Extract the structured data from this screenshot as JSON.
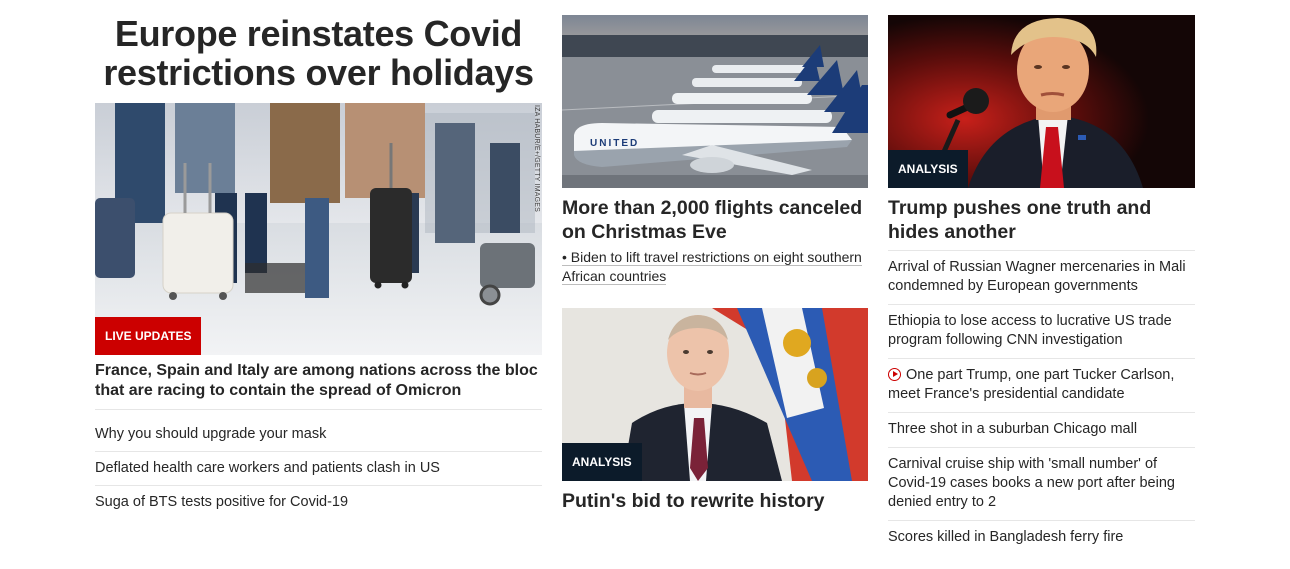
{
  "lead": {
    "title": "Europe reinstates Covid restrictions over holidays",
    "image_alt": "Travelers with rolling suitcases in an airport terminal",
    "photo_credit": "IZA HABUR/E+/GETTY IMAGES",
    "badge": "LIVE UPDATES",
    "subheadline": "France, Spain and Italy are among nations across the bloc that are racing to contain the spread of Omicron",
    "links": [
      "Why you should upgrade your mask",
      "Deflated health care workers and patients clash in US",
      "Suga of BTS tests positive for Covid-19"
    ]
  },
  "flights": {
    "image_alt": "United Airlines planes parked at an airport",
    "headline": "More than 2,000 flights canceled on Christmas Eve",
    "related": "Biden to lift travel restrictions on eight southern African countries",
    "plane_livery": "UNITED"
  },
  "putin": {
    "image_alt": "Vladimir Putin in front of a Russian flag",
    "badge": "ANALYSIS",
    "headline": "Putin's bid to rewrite history"
  },
  "trump": {
    "image_alt": "Donald Trump speaking at a microphone",
    "badge": "ANALYSIS",
    "headline": "Trump pushes one truth and hides another",
    "links": [
      "Arrival of Russian Wagner mercenaries in Mali condemned by European governments",
      "Ethiopia to lose access to lucrative US trade program following CNN investigation",
      "One part Trump, one part Tucker Carlson, meet France's presidential candidate",
      "Three shot in a suburban Chicago mall",
      "Carnival cruise ship with 'small number' of Covid-19 cases books a new port after being denied entry to 2",
      "Scores killed in Bangladesh ferry fire"
    ],
    "video_icon": "play-circle-icon"
  },
  "colors": {
    "text": "#262626",
    "badge_live": "#cc0000",
    "badge_analysis": "#0c1b2a",
    "divider": "#e6e6e6"
  }
}
